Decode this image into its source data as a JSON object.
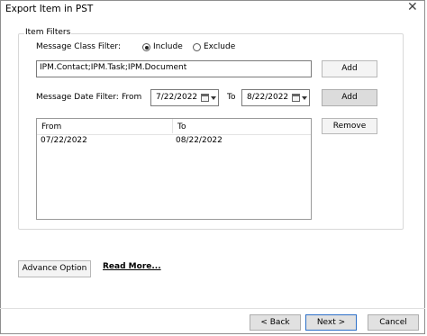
{
  "window": {
    "title": "Export Item in PST",
    "close_glyph": "✕"
  },
  "filters": {
    "group_label": "Item Filters",
    "message_class_label": "Message Class Filter:",
    "include_label": "Include",
    "exclude_label": "Exclude",
    "include_selected": true,
    "message_class_value": "IPM.Contact;IPM.Task;IPM.Document",
    "add_label_1": "Add",
    "date_filter_label": "Message Date Filter:",
    "from_label": "From",
    "to_label": "To",
    "from_date": "7/22/2022",
    "to_date": "8/22/2022",
    "add_label_2": "Add",
    "remove_label": "Remove"
  },
  "table": {
    "columns": [
      "From",
      "To"
    ],
    "rows": [
      {
        "from": "07/22/2022",
        "to": "08/22/2022"
      }
    ]
  },
  "bottom": {
    "advance_option_label": "Advance Option",
    "read_more_label": "Read More...",
    "back_label": "< Back",
    "next_label": "Next >",
    "cancel_label": "Cancel"
  },
  "icons": {
    "calendar": "calendar-icon",
    "dropdown": "chevron-down-icon",
    "close": "close-icon"
  }
}
